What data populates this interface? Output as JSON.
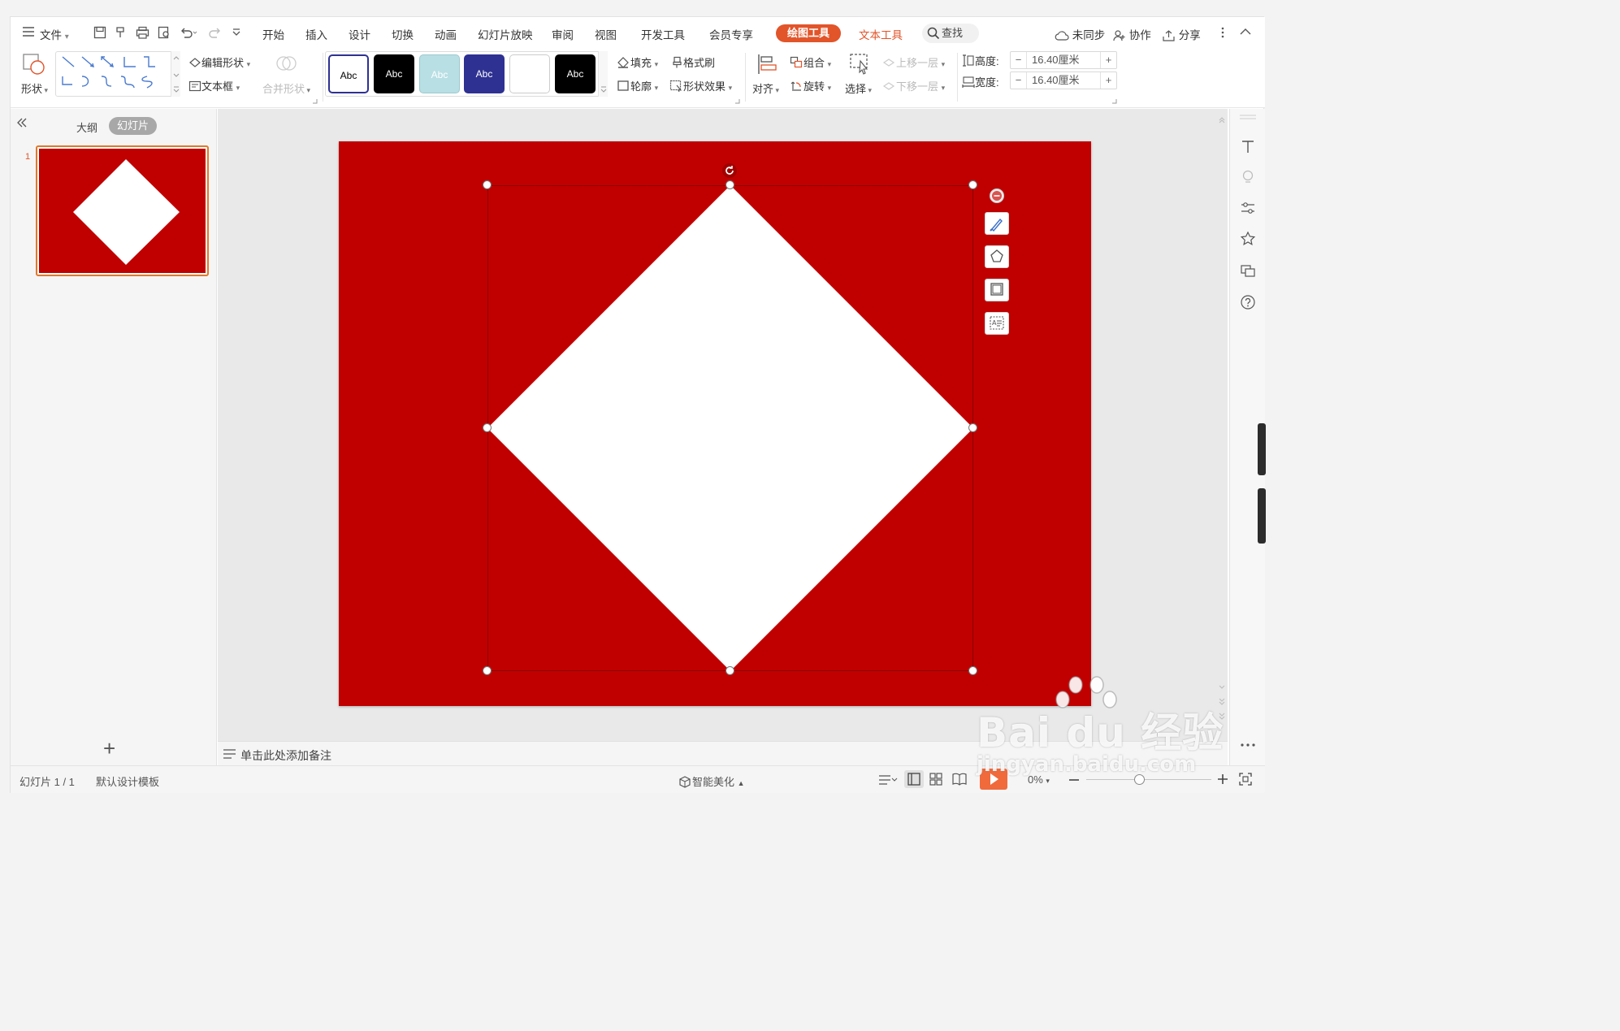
{
  "menubar": {
    "file": "文件",
    "tabs": [
      "开始",
      "插入",
      "设计",
      "切换",
      "动画",
      "幻灯片放映",
      "审阅",
      "视图",
      "开发工具",
      "会员专享"
    ],
    "active_tab": "绘图工具",
    "text_tools": "文本工具",
    "search": "查找",
    "sync": "未同步",
    "collab": "协作",
    "share": "分享"
  },
  "ribbon": {
    "shape": "形状",
    "edit_shape": "编辑形状",
    "textbox": "文本框",
    "merge_shape": "合并形状",
    "style_label": "Abc",
    "fill": "填充",
    "format_painter": "格式刷",
    "outline": "轮廓",
    "shape_effects": "形状效果",
    "align": "对齐",
    "group": "组合",
    "rotate": "旋转",
    "select": "选择",
    "bring_forward": "上移一层",
    "send_backward": "下移一层",
    "height_label": "高度:",
    "height_value": "16.40厘米",
    "width_label": "宽度:",
    "width_value": "16.40厘米",
    "minus": "−",
    "plus": "+"
  },
  "leftpanel": {
    "outline_tab": "大纲",
    "slides_tab": "幻灯片",
    "slide_number": "1",
    "add": "+"
  },
  "notes": {
    "placeholder": "单击此处添加备注"
  },
  "statusbar": {
    "slide_info": "幻灯片 1 / 1",
    "template": "默认设计模板",
    "beautify": "智能美化",
    "zoom": "0%"
  },
  "watermark": {
    "brand": "Bai du 经验",
    "url": "jingyan.baidu.com"
  },
  "colors": {
    "slide_bg": "#c00000",
    "accent_orange": "#e2542a",
    "shape_fill": "#ffffff"
  }
}
